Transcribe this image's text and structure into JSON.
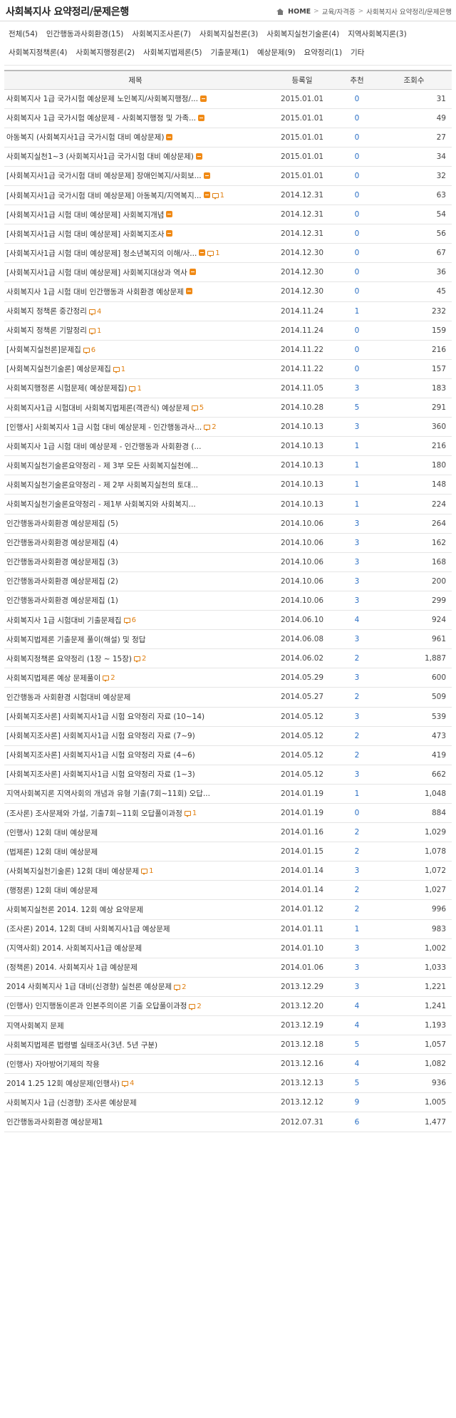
{
  "header": {
    "title": "사회복지사 요약정리/문제은행",
    "breadcrumb": [
      "HOME",
      "교육/자격증",
      "사회복지사 요약정리/문제은행"
    ]
  },
  "categories": [
    "전체(54)",
    "인간행동과사회환경(15)",
    "사회복지조사론(7)",
    "사회복지실천론(3)",
    "사회복지실천기술론(4)",
    "지역사회복지론(3)",
    "사회복지정책론(4)",
    "사회복지행정론(2)",
    "사회복지법제론(5)",
    "기출문제(1)",
    "예상문제(9)",
    "요약정리(1)",
    "기타"
  ],
  "table": {
    "headers": {
      "title": "제목",
      "date": "등록일",
      "recommend": "추천",
      "views": "조회수"
    },
    "rows": [
      {
        "title": "사회복지사 1급 국가시험 예상문제 노인복지/사회복지행정/...",
        "new": true,
        "comments": "",
        "date": "2015.01.01",
        "rec": "0",
        "views": "31"
      },
      {
        "title": "사회복지사 1급 국가시험 예상문제 - 사회복지행정 및 가족...",
        "new": true,
        "comments": "",
        "date": "2015.01.01",
        "rec": "0",
        "views": "49"
      },
      {
        "title": "아동복지 (사회복지사1급 국가시험 대비 예상문제)",
        "new": true,
        "comments": "",
        "date": "2015.01.01",
        "rec": "0",
        "views": "27"
      },
      {
        "title": "사회복지실천1~3 (사회복지사1급 국가시험 대비 예상문제)",
        "new": true,
        "comments": "",
        "date": "2015.01.01",
        "rec": "0",
        "views": "34"
      },
      {
        "title": "[사회복지사1급 국가시험 대비 예상문제] 장애인복지/사회보...",
        "new": true,
        "comments": "",
        "date": "2015.01.01",
        "rec": "0",
        "views": "32"
      },
      {
        "title": "[사회복지사1급 국가시험 대비 예상문제] 아동복지/지역복지...",
        "new": true,
        "comments": "1",
        "date": "2014.12.31",
        "rec": "0",
        "views": "63"
      },
      {
        "title": "[사회복지사1급 시험 대비 예상문제] 사회복지개념",
        "new": true,
        "comments": "",
        "date": "2014.12.31",
        "rec": "0",
        "views": "54"
      },
      {
        "title": "[사회복지사1급 시험 대비 예상문제] 사회복지조사",
        "new": true,
        "comments": "",
        "date": "2014.12.31",
        "rec": "0",
        "views": "56"
      },
      {
        "title": "[사회복지사1급 시험 대비 예상문제] 청소년복지의 이해/사...",
        "new": true,
        "comments": "1",
        "date": "2014.12.30",
        "rec": "0",
        "views": "67"
      },
      {
        "title": "[사회복지사1급 시험 대비 예상문제] 사회복지대상과 역사",
        "new": true,
        "comments": "",
        "date": "2014.12.30",
        "rec": "0",
        "views": "36"
      },
      {
        "title": "사회복지사 1급 시험 대비 인간행동과 사회환경 예상문제",
        "new": true,
        "comments": "",
        "date": "2014.12.30",
        "rec": "0",
        "views": "45"
      },
      {
        "title": "사회복지 정책론 중간정리",
        "new": false,
        "comments": "4",
        "date": "2014.11.24",
        "rec": "1",
        "views": "232"
      },
      {
        "title": "사회복지 정책론 기말정리",
        "new": false,
        "comments": "1",
        "date": "2014.11.24",
        "rec": "0",
        "views": "159"
      },
      {
        "title": "[사회복지실천론]문제집",
        "new": false,
        "comments": "6",
        "date": "2014.11.22",
        "rec": "0",
        "views": "216"
      },
      {
        "title": "[사회복지실천기술론] 예상문제집",
        "new": false,
        "comments": "1",
        "date": "2014.11.22",
        "rec": "0",
        "views": "157"
      },
      {
        "title": "사회복지행정론 시험문제( 예상문제집)",
        "new": false,
        "comments": "1",
        "date": "2014.11.05",
        "rec": "3",
        "views": "183"
      },
      {
        "title": "사회복지사1급 시험대비 사회복지법제론(객관식) 예상문제",
        "new": false,
        "comments": "5",
        "date": "2014.10.28",
        "rec": "5",
        "views": "291"
      },
      {
        "title": "[인행사] 사회복지사 1급 시험 대비 예상문제 - 인간행동과사...",
        "new": false,
        "comments": "2",
        "date": "2014.10.13",
        "rec": "3",
        "views": "360"
      },
      {
        "title": "사회복지사 1급 시험 대비 예상문제 - 인간행동과 사회환경 (...",
        "new": false,
        "comments": "",
        "date": "2014.10.13",
        "rec": "1",
        "views": "216"
      },
      {
        "title": "사회복지실천기술론요약정리 - 제 3부 모든 사회복지실천에...",
        "new": false,
        "comments": "",
        "date": "2014.10.13",
        "rec": "1",
        "views": "180"
      },
      {
        "title": "사회복지실천기술론요약정리 - 제 2부 사회복지실천의 토대...",
        "new": false,
        "comments": "",
        "date": "2014.10.13",
        "rec": "1",
        "views": "148"
      },
      {
        "title": "사회복지실천기술론요약정리 - 제1부 사회복지와 사회복지...",
        "new": false,
        "comments": "",
        "date": "2014.10.13",
        "rec": "1",
        "views": "224"
      },
      {
        "title": "인간행동과사회환경 예상문제집 (5)",
        "new": false,
        "comments": "",
        "date": "2014.10.06",
        "rec": "3",
        "views": "264"
      },
      {
        "title": "인간행동과사회환경 예상문제집 (4)",
        "new": false,
        "comments": "",
        "date": "2014.10.06",
        "rec": "3",
        "views": "162"
      },
      {
        "title": "인간행동과사회환경 예상문제집 (3)",
        "new": false,
        "comments": "",
        "date": "2014.10.06",
        "rec": "3",
        "views": "168"
      },
      {
        "title": "인간행동과사회환경 예상문제집 (2)",
        "new": false,
        "comments": "",
        "date": "2014.10.06",
        "rec": "3",
        "views": "200"
      },
      {
        "title": "인간행동과사회환경 예상문제집 (1)",
        "new": false,
        "comments": "",
        "date": "2014.10.06",
        "rec": "3",
        "views": "299"
      },
      {
        "title": "사회복지사 1급 시험대비 기출문제집",
        "new": false,
        "comments": "6",
        "date": "2014.06.10",
        "rec": "4",
        "views": "924"
      },
      {
        "title": "사회복지법제론 기출문제 풀이(해설) 및 정답",
        "new": false,
        "comments": "",
        "date": "2014.06.08",
        "rec": "3",
        "views": "961"
      },
      {
        "title": "사회복지정책론 요약정리 (1장 ~ 15장)",
        "new": false,
        "comments": "2",
        "date": "2014.06.02",
        "rec": "2",
        "views": "1,887"
      },
      {
        "title": "사회복지법제론 예상 문제풀이",
        "new": false,
        "comments": "2",
        "date": "2014.05.29",
        "rec": "3",
        "views": "600"
      },
      {
        "title": "인간행동과 사회환경 시험대비 예상문제",
        "new": false,
        "comments": "",
        "date": "2014.05.27",
        "rec": "2",
        "views": "509"
      },
      {
        "title": "[사회복지조사론] 사회복지사1급 시험 요약정리 자료 (10~14)",
        "new": false,
        "comments": "",
        "date": "2014.05.12",
        "rec": "3",
        "views": "539"
      },
      {
        "title": "[사회복지조사론] 사회복지사1급 시험 요약정리 자료 (7~9)",
        "new": false,
        "comments": "",
        "date": "2014.05.12",
        "rec": "2",
        "views": "473"
      },
      {
        "title": "[사회복지조사론] 사회복지사1급 시험 요약정리 자료 (4~6)",
        "new": false,
        "comments": "",
        "date": "2014.05.12",
        "rec": "2",
        "views": "419"
      },
      {
        "title": "[사회복지조사론] 사회복지사1급 시험 요약정리 자료 (1~3)",
        "new": false,
        "comments": "",
        "date": "2014.05.12",
        "rec": "3",
        "views": "662"
      },
      {
        "title": "지역사회복지론 지역사회의 개념과 유형 기출(7회~11회) 오답...",
        "new": false,
        "comments": "",
        "date": "2014.01.19",
        "rec": "1",
        "views": "1,048"
      },
      {
        "title": "(조사론) 조사문제와 가설, 기출7회~11회 오답풀이과정",
        "new": false,
        "comments": "1",
        "date": "2014.01.19",
        "rec": "0",
        "views": "884"
      },
      {
        "title": "(인행사) 12회 대비 예상문제",
        "new": false,
        "comments": "",
        "date": "2014.01.16",
        "rec": "2",
        "views": "1,029"
      },
      {
        "title": "(법제론) 12회 대비 예상문제",
        "new": false,
        "comments": "",
        "date": "2014.01.15",
        "rec": "2",
        "views": "1,078"
      },
      {
        "title": "(사회복지실천기술론) 12회 대비 예상문제",
        "new": false,
        "comments": "1",
        "date": "2014.01.14",
        "rec": "3",
        "views": "1,072"
      },
      {
        "title": "(행정론) 12회 대비 예상문제",
        "new": false,
        "comments": "",
        "date": "2014.01.14",
        "rec": "2",
        "views": "1,027"
      },
      {
        "title": "사회복지실천론 2014. 12회 예상 요약문제",
        "new": false,
        "comments": "",
        "date": "2014.01.12",
        "rec": "2",
        "views": "996"
      },
      {
        "title": "(조사론) 2014, 12회 대비 사회복지사1급 예상문제",
        "new": false,
        "comments": "",
        "date": "2014.01.11",
        "rec": "1",
        "views": "983"
      },
      {
        "title": "(지역사회) 2014. 사회복지사1급 예상문제",
        "new": false,
        "comments": "",
        "date": "2014.01.10",
        "rec": "3",
        "views": "1,002"
      },
      {
        "title": "(정책론) 2014. 사회복지사 1급 예상문제",
        "new": false,
        "comments": "",
        "date": "2014.01.06",
        "rec": "3",
        "views": "1,033"
      },
      {
        "title": "2014 사회복지사 1급 대비(신경향) 실천론 예상문제",
        "new": false,
        "comments": "2",
        "date": "2013.12.29",
        "rec": "3",
        "views": "1,221"
      },
      {
        "title": "(인행사) 인지행동이론과 인본주의이론 기출 오답풀이과정",
        "new": false,
        "comments": "2",
        "date": "2013.12.20",
        "rec": "4",
        "views": "1,241"
      },
      {
        "title": "지역사회복지 문제",
        "new": false,
        "comments": "",
        "date": "2013.12.19",
        "rec": "4",
        "views": "1,193"
      },
      {
        "title": "사회복지법제론 법령별 실태조사(3년. 5년 구분)",
        "new": false,
        "comments": "",
        "date": "2013.12.18",
        "rec": "5",
        "views": "1,057"
      },
      {
        "title": "(인행사) 자아방어기제의 작용",
        "new": false,
        "comments": "",
        "date": "2013.12.16",
        "rec": "4",
        "views": "1,082"
      },
      {
        "title": "2014 1.25 12회 예상문제(인행사)",
        "new": false,
        "comments": "4",
        "date": "2013.12.13",
        "rec": "5",
        "views": "936"
      },
      {
        "title": "사회복지사 1급 (신경향) 조사론 예상문제",
        "new": false,
        "comments": "",
        "date": "2013.12.12",
        "rec": "9",
        "views": "1,005"
      },
      {
        "title": "인간행동과사회환경 예상문제1",
        "new": false,
        "comments": "",
        "date": "2012.07.31",
        "rec": "6",
        "views": "1,477"
      }
    ]
  }
}
